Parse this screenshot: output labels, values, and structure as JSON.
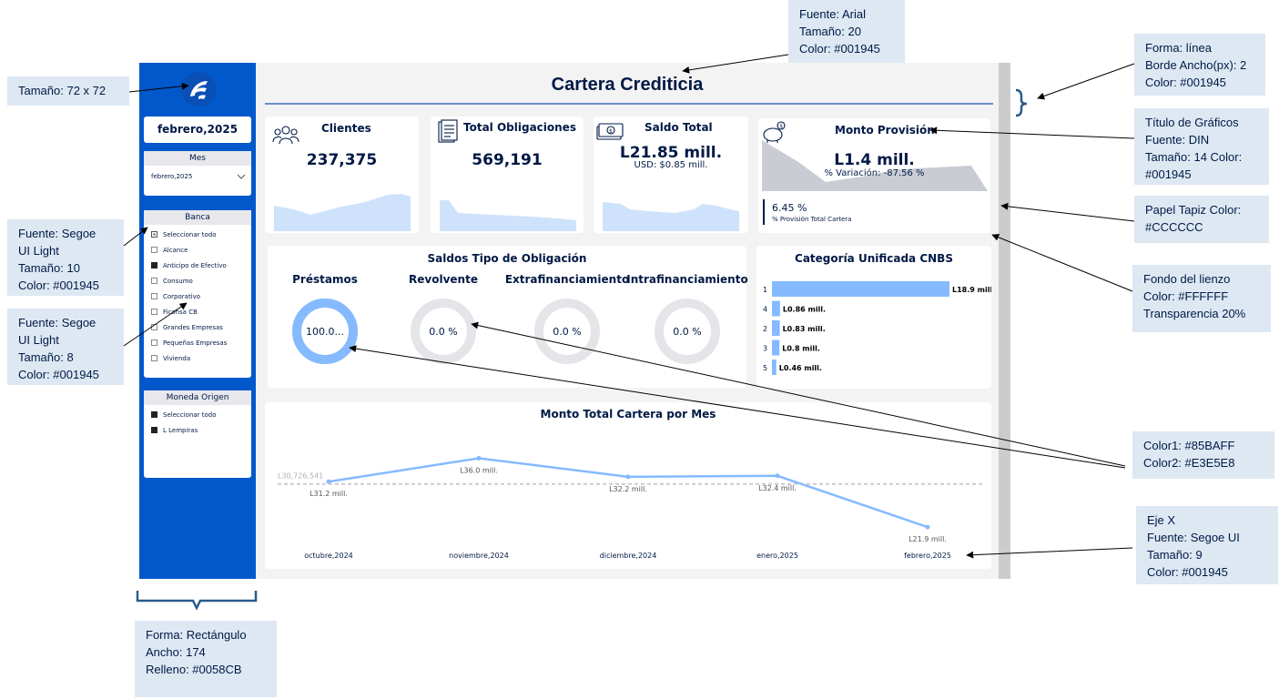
{
  "dashboard": {
    "title": "Cartera Crediticia",
    "period": "febrero,2025"
  },
  "filters": {
    "mes": {
      "title": "Mes",
      "value": "febrero,2025"
    },
    "banca": {
      "title": "Banca",
      "items": [
        {
          "label": "Seleccionar todo",
          "state": "partial"
        },
        {
          "label": "Alcance",
          "state": "off"
        },
        {
          "label": "Anticipo de Efectivo",
          "state": "on"
        },
        {
          "label": "Consumo",
          "state": "off"
        },
        {
          "label": "Corporativo",
          "state": "off"
        },
        {
          "label": "Ficohsa CB",
          "state": "off"
        },
        {
          "label": "Grandes Empresas",
          "state": "off"
        },
        {
          "label": "Pequeñas Empresas",
          "state": "off"
        },
        {
          "label": "Vivienda",
          "state": "off"
        }
      ]
    },
    "moneda": {
      "title": "Moneda Origen",
      "items": [
        {
          "label": "Seleccionar todo",
          "state": "on"
        },
        {
          "label": "L Lempiras",
          "state": "on"
        }
      ]
    }
  },
  "kpis": {
    "clientes": {
      "title": "Clientes",
      "value": "237,375",
      "icon": "people-icon"
    },
    "obligaciones": {
      "title": "Total Obligaciones",
      "value": "569,191",
      "icon": "document-icon"
    },
    "saldo": {
      "title": "Saldo Total",
      "value": "L21.85 mill.",
      "usd": "USD: $0.85 mill.",
      "icon": "money-icon"
    },
    "provision": {
      "title": "Monto Provisión",
      "value": "L1.4 mill.",
      "variation": "% Variación: -87.56 %",
      "pct": "6.45 %",
      "pct_label": "% Provisión Total Cartera",
      "icon": "piggy-bank-icon"
    }
  },
  "donuts": {
    "title": "Saldos Tipo de Obligación",
    "items": [
      {
        "label": "Préstamos",
        "text": "100.0...",
        "fraction": 1.0
      },
      {
        "label": "Revolvente",
        "text": "0.0 %",
        "fraction": 0
      },
      {
        "label": "Extrafinanciamiento",
        "text": "0.0 %",
        "fraction": 0
      },
      {
        "label": "Intrafinanciamiento",
        "text": "0.0 %",
        "fraction": 0
      }
    ]
  },
  "chart_data": [
    {
      "type": "bar",
      "title": "Categoría Unificada CNBS",
      "categories": [
        "1",
        "4",
        "2",
        "3",
        "5"
      ],
      "values": [
        18.9,
        0.86,
        0.83,
        0.8,
        0.46
      ],
      "labels": [
        "L18.9 mill.",
        "L0.86 mill.",
        "L0.83 mill.",
        "L0.8 mill.",
        "L0.46 mill."
      ]
    },
    {
      "type": "line",
      "title": "Monto Total Cartera por Mes",
      "categories": [
        "octubre,2024",
        "noviembre,2024",
        "diciembre,2024",
        "enero,2025",
        "febrero,2025"
      ],
      "values": [
        31.2,
        36.0,
        32.2,
        32.4,
        21.9
      ],
      "labels": [
        "L31.2 mill.",
        "L36.0 mill.",
        "L32.2 mill.",
        "L32.4 mill.",
        "L21.9 mill."
      ],
      "reference_value": 30.726541,
      "reference_label": "L30,726,541",
      "ylim": [
        18,
        40
      ]
    }
  ],
  "annotations": {
    "logo_size": "Tamaño: 72 x 72",
    "title_font": "Fuente: Arial\nTamaño: 20\nColor: #001945",
    "line_shape": "Forma: línea\nBorde Ancho(px): 2\nColor: #001945",
    "chart_title": "Título de Gráficos\nFuente: DIN\nTamaño: 14 Color:\n#001945",
    "wallpaper": "Papel Tapiz  Color:\n#CCCCCC",
    "canvas_bg": "Fondo del lienzo\nColor: #FFFFFF\nTransparencia 20%",
    "segoe_10": "Fuente: Segoe\nUI Light\nTamaño: 10\nColor: #001945",
    "segoe_8": "Fuente: Segoe\nUI Light\nTamaño: 8\nColor: #001945",
    "colors": "Color1: #85BAFF\nColor2: #E3E5E8",
    "x_axis": "Eje X\nFuente: Segoe UI\nTamaño: 9\nColor: #001945",
    "rect": "Forma: Rectángulo\nAncho: 174\nRelleno: #0058CB"
  },
  "colors": {
    "sidebar": "#0058CB",
    "primary": "#001945",
    "color1": "#85BAFF",
    "color2": "#E3E5E8",
    "wallpaper": "#CCCCCC"
  }
}
